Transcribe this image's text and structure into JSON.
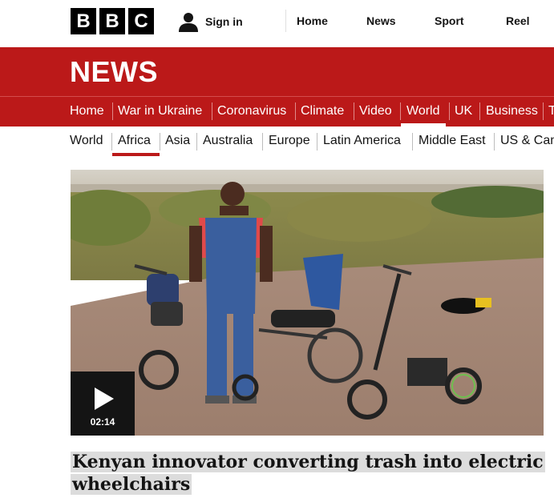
{
  "header": {
    "logo_letters": [
      "B",
      "B",
      "C"
    ],
    "signin_label": "Sign in",
    "topnav": [
      "Home",
      "News",
      "Sport",
      "Reel"
    ]
  },
  "banner": {
    "title": "NEWS"
  },
  "main_nav": {
    "items": [
      "Home",
      "War in Ukraine",
      "Coronavirus",
      "Climate",
      "Video",
      "World",
      "UK",
      "Business",
      "T"
    ],
    "active": "World"
  },
  "sub_nav": {
    "items": [
      "World",
      "Africa",
      "Asia",
      "Australia",
      "Europe",
      "Latin America",
      "Middle East",
      "US & Can"
    ],
    "active": "Africa"
  },
  "video": {
    "duration": "02:14",
    "icon": "play-icon"
  },
  "headline": "Kenyan innovator converting trash into electric wheelchairs",
  "colors": {
    "brand_red": "#bb1919",
    "text": "#141414",
    "highlight": "#dcdcdc"
  }
}
